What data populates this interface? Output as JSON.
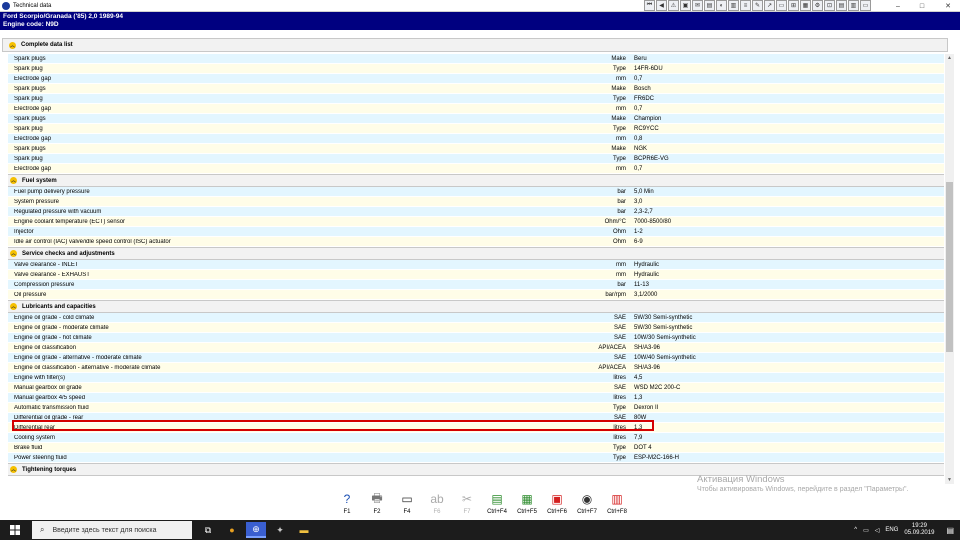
{
  "window": {
    "title": "Technical data",
    "minimize": "–",
    "maximize": "□",
    "close": "✕"
  },
  "toolbar": [
    "⏮",
    "◀",
    "⚠",
    "▣",
    "✉",
    "▤",
    "◐",
    "▥",
    "≡",
    "✎",
    "↗",
    "▭",
    "⊞",
    "▦",
    "⚙",
    "⊡",
    "▤",
    "▥",
    "▭"
  ],
  "vehicle": {
    "line1": "Ford   Scorpio/Granada ('85) 2,0   1989-94",
    "line2": "Engine code: N9D"
  },
  "section": "Complete data list",
  "spark_rows": [
    {
      "label": "Spark plugs",
      "unit": "Make",
      "value": "Beru"
    },
    {
      "label": "Spark plug",
      "unit": "Type",
      "value": "14FR-6DU"
    },
    {
      "label": "Electrode gap",
      "unit": "mm",
      "value": "0,7"
    },
    {
      "label": "Spark plugs",
      "unit": "Make",
      "value": "Bosch"
    },
    {
      "label": "Spark plug",
      "unit": "Type",
      "value": "FR6DC"
    },
    {
      "label": "Electrode gap",
      "unit": "mm",
      "value": "0,7"
    },
    {
      "label": "Spark plugs",
      "unit": "Make",
      "value": "Champion"
    },
    {
      "label": "Spark plug",
      "unit": "Type",
      "value": "RC9YCC"
    },
    {
      "label": "Electrode gap",
      "unit": "mm",
      "value": "0,8"
    },
    {
      "label": "Spark plugs",
      "unit": "Make",
      "value": "NGK"
    },
    {
      "label": "Spark plug",
      "unit": "Type",
      "value": "BCPR6E-VG"
    },
    {
      "label": "Electrode gap",
      "unit": "mm",
      "value": "0,7"
    }
  ],
  "fuel_title": "Fuel system",
  "fuel_rows": [
    {
      "label": "Fuel pump delivery pressure",
      "unit": "bar",
      "value": "5,0 Min"
    },
    {
      "label": "System pressure",
      "unit": "bar",
      "value": "3,0"
    },
    {
      "label": "Regulated pressure with vacuum",
      "unit": "bar",
      "value": "2,3-2,7"
    },
    {
      "label": "Engine coolant temperature (ECT) sensor",
      "unit": "Ohm/°C",
      "value": "7000-8500/80"
    },
    {
      "label": "Injector",
      "unit": "Ohm",
      "value": "1-2"
    },
    {
      "label": "Idle air control (IAC) valve/idle speed control (ISC) actuator",
      "unit": "Ohm",
      "value": "6-9"
    }
  ],
  "service_title": "Service checks and adjustments",
  "service_rows": [
    {
      "label": "Valve clearance - INLET",
      "unit": "mm",
      "value": "Hydraulic"
    },
    {
      "label": "Valve clearance - EXHAUST",
      "unit": "mm",
      "value": "Hydraulic"
    },
    {
      "label": "Compression pressure",
      "unit": "bar",
      "value": "11-13"
    },
    {
      "label": "Oil pressure",
      "unit": "bar/rpm",
      "value": "3,1/2000"
    }
  ],
  "lub_title": "Lubricants and capacities",
  "lub_rows": [
    {
      "label": "Engine oil grade - cold climate",
      "unit": "SAE",
      "value": "5W/30  Semi-synthetic"
    },
    {
      "label": "Engine oil grade - moderate climate",
      "unit": "SAE",
      "value": "5W/30  Semi-synthetic"
    },
    {
      "label": "Engine oil grade - hot climate",
      "unit": "SAE",
      "value": "10W/30  Semi-synthetic"
    },
    {
      "label": "Engine oil classification",
      "unit": "API/ACEA",
      "value": "SH/A3-96"
    },
    {
      "label": "Engine oil grade - alternative - moderate climate",
      "unit": "SAE",
      "value": "10W/40  Semi-synthetic"
    },
    {
      "label": "Engine oil classification - alternative - moderate climate",
      "unit": "API/ACEA",
      "value": "SH/A3-96"
    },
    {
      "label": "Engine with filter(s)",
      "unit": "litres",
      "value": "4,5"
    },
    {
      "label": "Manual gearbox oil grade",
      "unit": "SAE",
      "value": "WSD M2C 200-C"
    },
    {
      "label": "Manual gearbox 4/5 speed",
      "unit": "litres",
      "value": "1,3"
    },
    {
      "label": "Automatic transmission fluid",
      "unit": "Type",
      "value": "Dexron II"
    },
    {
      "label": "Differential oil grade - rear",
      "unit": "SAE",
      "value": "80W"
    },
    {
      "label": "Differential rear",
      "unit": "litres",
      "value": "1,3"
    },
    {
      "label": "Cooling system",
      "unit": "litres",
      "value": "7,9"
    },
    {
      "label": "Brake fluid",
      "unit": "Type",
      "value": "DOT 4"
    },
    {
      "label": "Power steering fluid",
      "unit": "Type",
      "value": "ESP-M2C-166-H"
    }
  ],
  "torque_title": "Tightening torques",
  "watermark": {
    "line1": "Активация Windows",
    "line2": "Чтобы активировать Windows, перейдите в раздел \"Параметры\"."
  },
  "fkeys": [
    {
      "label": "F1",
      "icon": "?",
      "color": "#1a4fb4",
      "enabled": true
    },
    {
      "label": "F2",
      "icon": "🖶",
      "color": "#777",
      "enabled": true
    },
    {
      "label": "F4",
      "icon": "▭",
      "color": "#333",
      "enabled": true
    },
    {
      "label": "F6",
      "icon": "ab",
      "color": "#aaa",
      "enabled": false
    },
    {
      "label": "F7",
      "icon": "✂",
      "color": "#aaa",
      "enabled": false
    },
    {
      "label": "Ctrl+F4",
      "icon": "▤",
      "color": "#2a8a2a",
      "enabled": true
    },
    {
      "label": "Ctrl+F5",
      "icon": "▦",
      "color": "#2a8a2a",
      "enabled": true
    },
    {
      "label": "Ctrl+F6",
      "icon": "▣",
      "color": "#d42020",
      "enabled": true
    },
    {
      "label": "Ctrl+F7",
      "icon": "◉",
      "color": "#333",
      "enabled": true
    },
    {
      "label": "Ctrl+F8",
      "icon": "▥",
      "color": "#d42020",
      "enabled": true
    }
  ],
  "taskbar": {
    "search_placeholder": "Введите здесь текст для поиска",
    "lang": "ENG",
    "time": "19:29",
    "date": "05.09.2019"
  },
  "colors": {
    "header_bg": "#000080",
    "row_even": "#e3f6ff",
    "row_odd": "#fffde8",
    "highlight": "#d40000"
  }
}
